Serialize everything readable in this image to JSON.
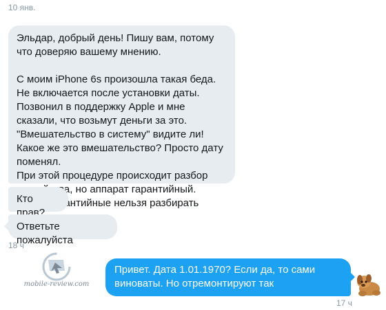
{
  "conversation": {
    "date_label": "10 янв.",
    "incoming": [
      {
        "paragraphs": [
          "Эльдар, добрый день! Пишу вам, потому что доверяю вашему мнению.",
          "С моим iPhone 6s произошла такая беда. Не включается после установки даты. Позвонил в поддержку Apple и мне сказали, что возьмут деньги за это. \"Вмешательство в систему\" видите ли! Какое же это вмешательство? Просто дату поменял.\nПри этой процедуре происходит разбор устройства, но аппарат гарантийный. Вроде гарантийные нельзя разбирать"
        ]
      },
      {
        "text": "Кто прав?"
      },
      {
        "text": "Ответьте пожалуйста"
      }
    ],
    "incoming_time": "18 ч",
    "outgoing": {
      "text": "Привет. Дата 1.01.1970? Если да, то сами виноваты. Но отремонтируют так",
      "time": "17 ч",
      "avatar_icon": "puppy-avatar"
    }
  },
  "watermark": {
    "text": "mobile-review.com",
    "icon": "mobile-review-logo"
  },
  "colors": {
    "incoming_bubble": "#e6ecf0",
    "outgoing_bubble": "#1da1f2",
    "timestamp": "#8899a6"
  }
}
